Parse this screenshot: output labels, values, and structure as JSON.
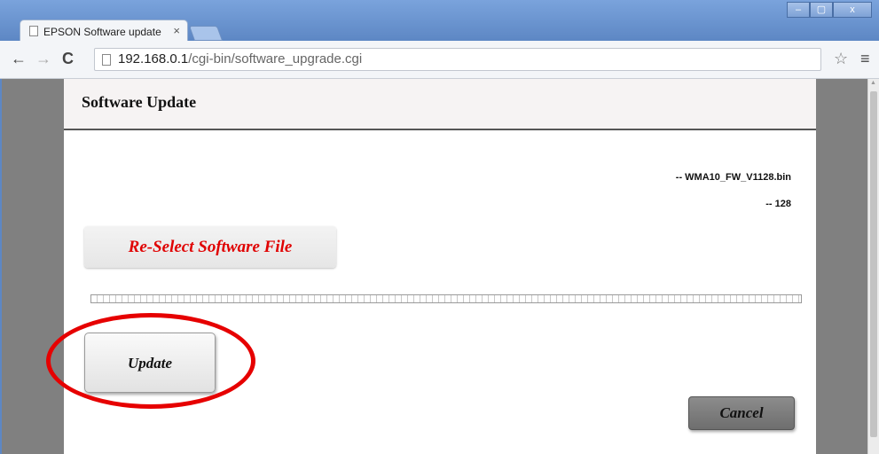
{
  "browser": {
    "tab_title": "EPSON Software update",
    "tab_close": "×",
    "url_host": "192.168.0.1",
    "url_path": "/cgi-bin/software_upgrade.cgi",
    "back": "←",
    "forward": "→",
    "reload": "C",
    "star": "☆",
    "menu": "≡",
    "minimize": "–",
    "maximize": "▢",
    "close": "x"
  },
  "page": {
    "title": "Software Update",
    "file_name": "-- WMA10_FW_V1128.bin",
    "file_version": "-- 128",
    "reselect_label": "Re-Select Software File",
    "update_label": "Update",
    "cancel_label": "Cancel"
  },
  "colors": {
    "accent_red": "#e60000",
    "window_frame": "#6b8fc4"
  }
}
